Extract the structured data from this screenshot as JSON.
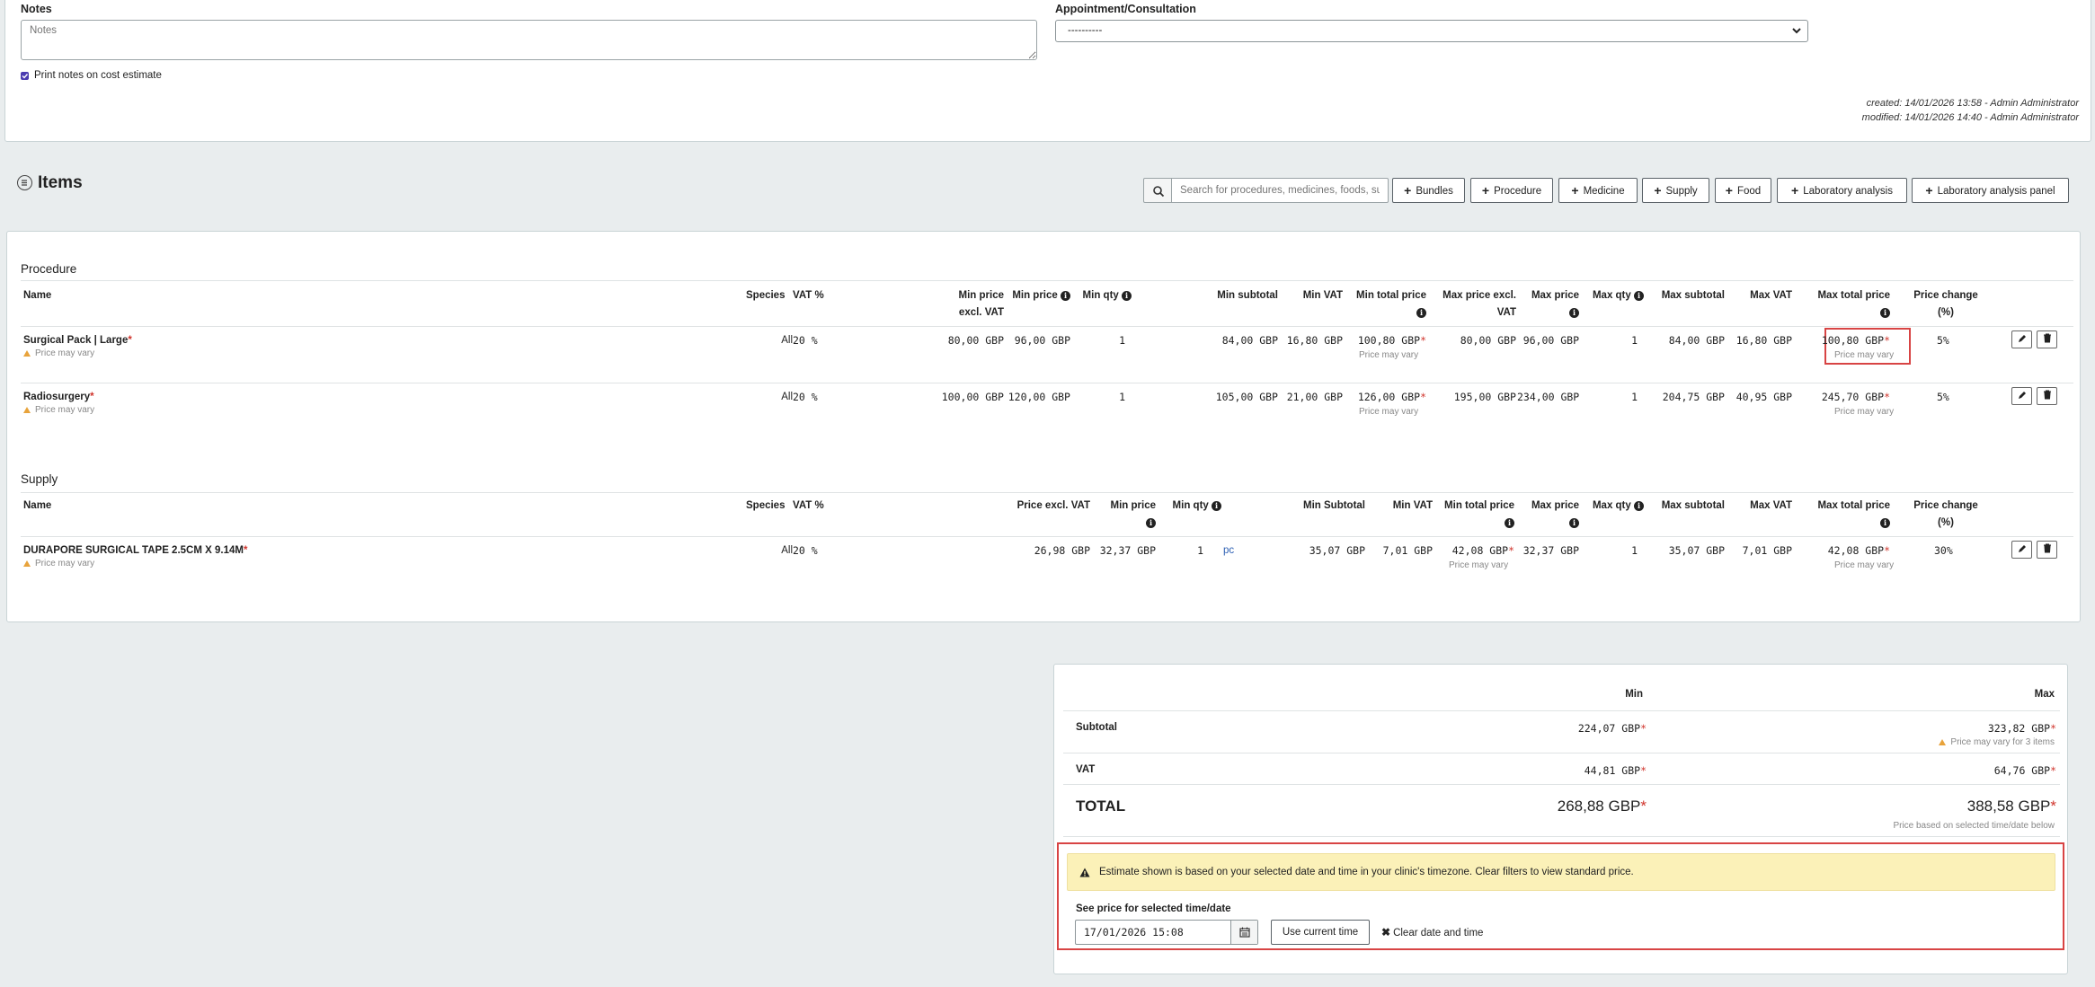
{
  "top": {
    "notes_label": "Notes",
    "notes_placeholder": "Notes",
    "appointment_label": "Appointment/Consultation",
    "appointment_value": "----------",
    "print_notes_label": "Print notes on cost estimate",
    "created": "created: 14/01/2026 13:58 - Admin Administrator",
    "modified": "modified: 14/01/2026 14:40 - Admin Administrator"
  },
  "items_header": {
    "title": "Items",
    "search_placeholder": "Search for procedures, medicines, foods, supplies...",
    "buttons": [
      "Bundles",
      "Procedure",
      "Medicine",
      "Supply",
      "Food",
      "Laboratory analysis",
      "Laboratory analysis panel"
    ]
  },
  "procedure": {
    "title": "Procedure",
    "headers": {
      "name": "Name",
      "species": "Species",
      "vat": "VAT %",
      "min_price_excl_1": "Min price",
      "min_price_excl_2": "excl. VAT",
      "min_price": "Min price",
      "min_qty": "Min qty",
      "min_subtotal": "Min subtotal",
      "min_vat": "Min VAT",
      "min_total": "Min total price",
      "max_price_excl_1": "Max price excl.",
      "max_price_excl_2": "VAT",
      "max_price": "Max price",
      "max_qty": "Max qty",
      "max_subtotal": "Max subtotal",
      "max_vat": "Max VAT",
      "max_total": "Max total price",
      "price_change_1": "Price change",
      "price_change_2": "(%)"
    },
    "rows": [
      {
        "name": "Surgical Pack | Large",
        "note": "Price may vary",
        "species": "All",
        "vat": "20 %",
        "min_price_excl": "80,00 GBP",
        "min_price": "96,00 GBP",
        "min_qty": "1",
        "min_subtotal": "84,00 GBP",
        "min_vat": "16,80 GBP",
        "min_total": "100,80 GBP",
        "min_total_note": "Price may vary",
        "max_price_excl": "80,00 GBP",
        "max_price": "96,00 GBP",
        "max_qty": "1",
        "max_subtotal": "84,00 GBP",
        "max_vat": "16,80 GBP",
        "max_total": "100,80 GBP",
        "max_total_note": "Price may vary",
        "price_change": "5%"
      },
      {
        "name": "Radiosurgery",
        "note": "Price may vary",
        "species": "All",
        "vat": "20 %",
        "min_price_excl": "100,00 GBP",
        "min_price": "120,00 GBP",
        "min_qty": "1",
        "min_subtotal": "105,00 GBP",
        "min_vat": "21,00 GBP",
        "min_total": "126,00 GBP",
        "min_total_note": "Price may vary",
        "max_price_excl": "195,00 GBP",
        "max_price": "234,00 GBP",
        "max_qty": "1",
        "max_subtotal": "204,75 GBP",
        "max_vat": "40,95 GBP",
        "max_total": "245,70 GBP",
        "max_total_note": "Price may vary",
        "price_change": "5%"
      }
    ]
  },
  "supply": {
    "title": "Supply",
    "headers": {
      "name": "Name",
      "species": "Species",
      "vat": "VAT %",
      "price_excl": "Price excl. VAT",
      "min_price": "Min price",
      "min_qty": "Min qty",
      "min_subtotal": "Min Subtotal",
      "min_vat": "Min VAT",
      "min_total": "Min total price",
      "max_price": "Max price",
      "max_qty": "Max qty",
      "max_subtotal": "Max subtotal",
      "max_vat": "Max VAT",
      "max_total": "Max total price",
      "price_change_1": "Price change",
      "price_change_2": "(%)"
    },
    "rows": [
      {
        "name": "DURAPORE SURGICAL TAPE 2.5CM X 9.14M",
        "note": "Price may vary",
        "species": "All",
        "vat": "20 %",
        "price_excl": "26,98 GBP",
        "min_price": "32,37 GBP",
        "min_qty": "1",
        "unit": "pc",
        "min_subtotal": "35,07 GBP",
        "min_vat": "7,01 GBP",
        "min_total": "42,08 GBP",
        "min_total_note": "Price may vary",
        "max_price": "32,37 GBP",
        "max_qty": "1",
        "max_subtotal": "35,07 GBP",
        "max_vat": "7,01 GBP",
        "max_total": "42,08 GBP",
        "max_total_note": "Price may vary",
        "price_change": "30%"
      }
    ]
  },
  "summary": {
    "min_label": "Min",
    "max_label": "Max",
    "subtotal_label": "Subtotal",
    "subtotal_min": "224,07 GBP",
    "subtotal_max": "323,82 GBP",
    "subtotal_note": "Price may vary for 3 items",
    "vat_label": "VAT",
    "vat_min": "44,81 GBP",
    "vat_max": "64,76 GBP",
    "total_label": "TOTAL",
    "total_min": "268,88 GBP",
    "total_max": "388,58 GBP",
    "total_note": "Price based on selected time/date below",
    "alert": "Estimate shown is based on your selected date and time in your clinic's timezone. Clear filters to view standard price.",
    "see_price_label": "See price for selected time/date",
    "datetime_value": "17/01/2026 15:08",
    "use_current_label": "Use current time",
    "clear_label": "Clear date and time"
  }
}
